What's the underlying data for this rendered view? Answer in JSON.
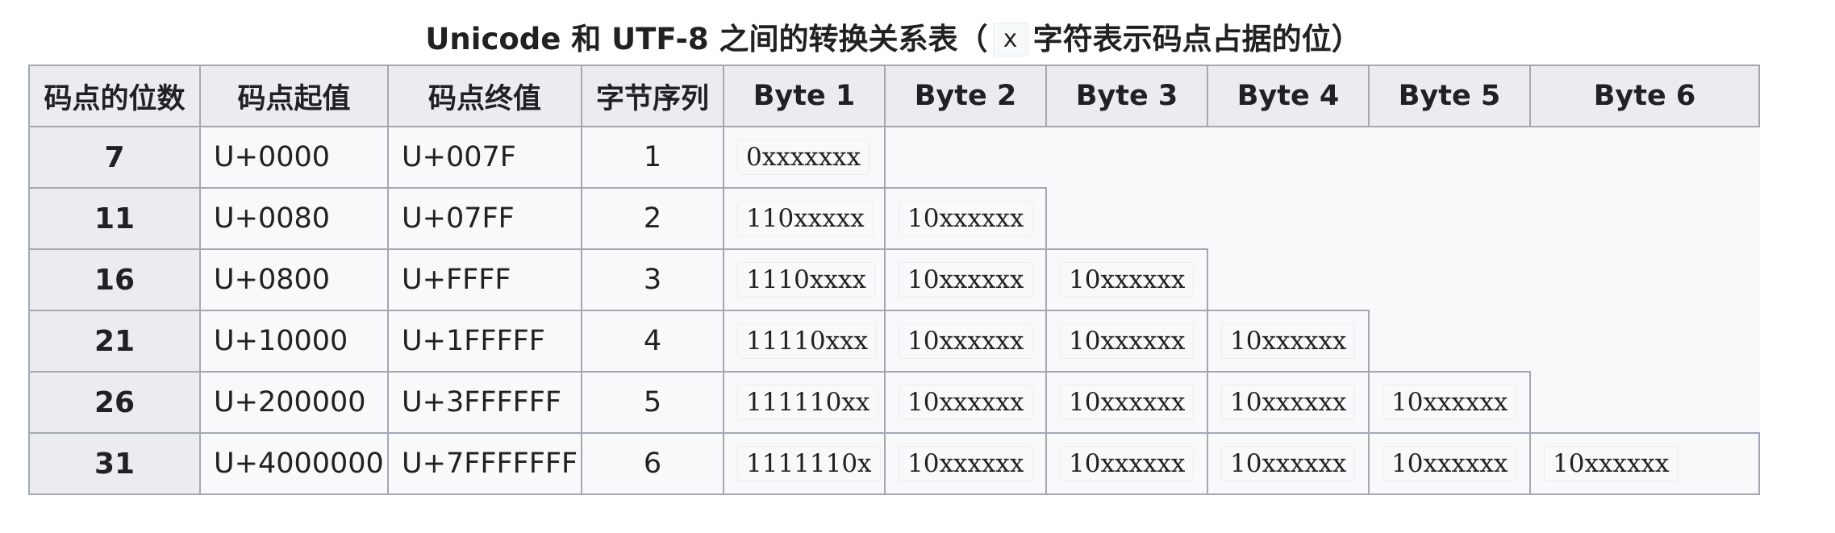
{
  "title": {
    "prefix": "Unicode 和 UTF-8 之间的转换关系表（",
    "code": "x",
    "suffix": "字符表示码点占据的位）"
  },
  "headers": [
    "码点的位数",
    "码点起值",
    "码点终值",
    "字节序列",
    "Byte 1",
    "Byte 2",
    "Byte 3",
    "Byte 4",
    "Byte 5",
    "Byte 6"
  ],
  "rows": [
    {
      "bits": "7",
      "start": "U+0000",
      "end": "U+007F",
      "seq": "1",
      "bytes": [
        "0xxxxxxx"
      ]
    },
    {
      "bits": "11",
      "start": "U+0080",
      "end": "U+07FF",
      "seq": "2",
      "bytes": [
        "110xxxxx",
        "10xxxxxx"
      ]
    },
    {
      "bits": "16",
      "start": "U+0800",
      "end": "U+FFFF",
      "seq": "3",
      "bytes": [
        "1110xxxx",
        "10xxxxxx",
        "10xxxxxx"
      ]
    },
    {
      "bits": "21",
      "start": "U+10000",
      "end": "U+1FFFFF",
      "seq": "4",
      "bytes": [
        "11110xxx",
        "10xxxxxx",
        "10xxxxxx",
        "10xxxxxx"
      ]
    },
    {
      "bits": "26",
      "start": "U+200000",
      "end": "U+3FFFFFF",
      "seq": "5",
      "bytes": [
        "111110xx",
        "10xxxxxx",
        "10xxxxxx",
        "10xxxxxx",
        "10xxxxxx"
      ]
    },
    {
      "bits": "31",
      "start": "U+4000000",
      "end": "U+7FFFFFFF",
      "seq": "6",
      "bytes": [
        "1111110x",
        "10xxxxxx",
        "10xxxxxx",
        "10xxxxxx",
        "10xxxxxx",
        "10xxxxxx"
      ]
    }
  ]
}
